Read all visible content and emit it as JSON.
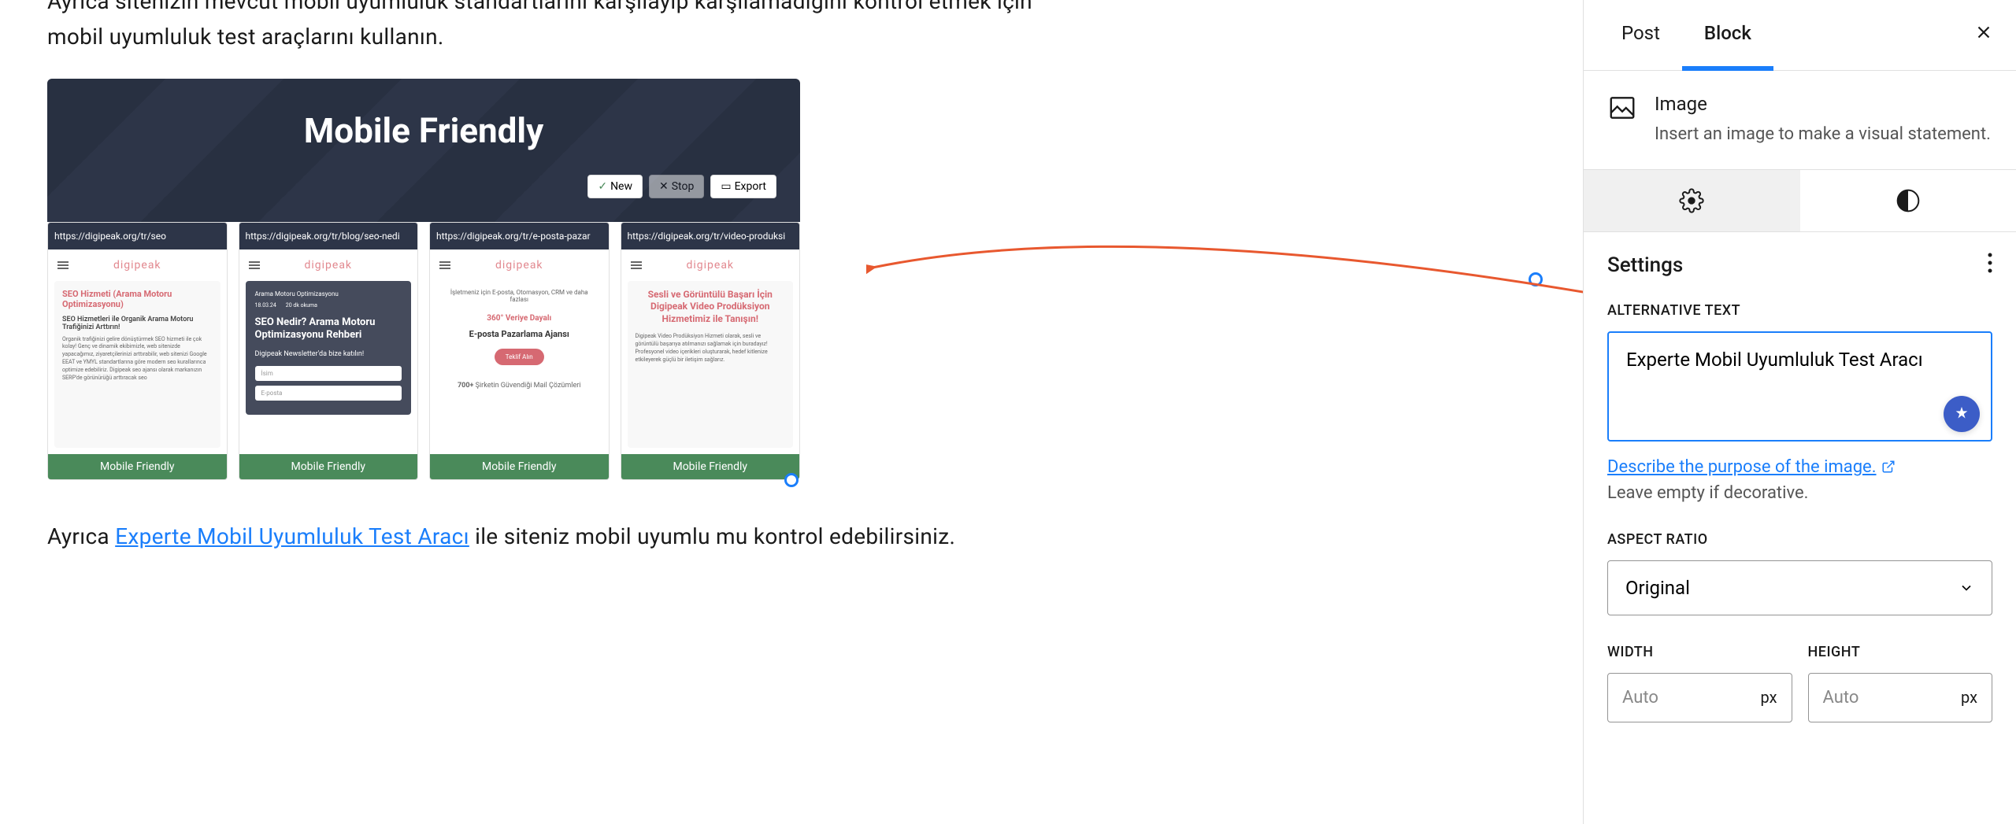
{
  "content": {
    "para1_line1": "Ayrıca sitenizin mevcut mobil uyumluluk standartlarını karşılayıp karşılamadığını kontrol etmek için",
    "para1_line2": "mobil uyumluluk test araçlarını kullanın.",
    "para2_before": "Ayrıca ",
    "para2_link": "Experte Mobil Uyumluluk Test Aracı",
    "para2_after": " ile siteniz mobil uyumlu mu kontrol edebilirsiniz."
  },
  "image": {
    "header_title": "Mobile Friendly",
    "btn_new": "New",
    "btn_stop": "Stop",
    "btn_export": "Export",
    "badge": "Mobile Friendly",
    "cards": [
      {
        "url": "https://digipeak.org/tr/seo",
        "logo": "digipeak",
        "title": "SEO Hizmeti (Arama Motoru Optimizasyonu)",
        "subtitle": "SEO Hizmetleri ile Organik Arama Motoru Trafiğinizi Arttırın!",
        "text": "Organik trafiğinizi gelire dönüştürmek SEO hizmeti ile çok kolay! Genç ve dinamik ekibimizle, web sitenizde yapacağımız, ziyaretçilerinizi arttırabilir, web sitenizi Google EEAT ve YMYL standartlarına göre modern seo kurallarınca optimize edebiliriz. Digipeak seo ajansı olarak markanızın SERP'de görünürüğü arttıracak seo"
      },
      {
        "url": "https://digipeak.org/tr/blog/seo-nedi",
        "logo": "digipeak",
        "category": "Arama Motoru Optimizasyonu",
        "date": "18.03.24",
        "read": "20 dk okuma",
        "title": "SEO Nedir? Arama Motoru Optimizasyonu Rehberi",
        "newsletter": "Digipeak Newsletter'da bize katılın!",
        "input1": "İsim",
        "input2": "E-posta"
      },
      {
        "url": "https://digipeak.org/tr/e-posta-pazar",
        "logo": "digipeak",
        "intro": "İşletmeniz için E-posta, Otomasyon, CRM ve daha fazlası",
        "tag": "360° Veriye Dayalı",
        "title": "E-posta Pazarlama Ajansı",
        "button": "Teklif Alın",
        "footer_bold": "700+",
        "footer_text": " Şirketin Güvendiği Mail Çözümleri"
      },
      {
        "url": "https://digipeak.org/tr/video-produksi",
        "logo": "digipeak",
        "title": "Sesli ve Görüntülü Başarı İçin Digipeak Video Prodüksiyon Hizmetimiz ile Tanışın!",
        "text": "Digipeak Video Prodüksiyon Hizmeti olarak, sesli ve görüntülü başarıya atılmanızı sağlamak için buradayız! Profesyonel video içerikleri oluşturarak, hedef kitlenize etkileyerek güçlü bir iletişim sağlarız."
      }
    ]
  },
  "sidebar": {
    "tabs": {
      "post": "Post",
      "block": "Block"
    },
    "block_info": {
      "name": "Image",
      "desc": "Insert an image to make a visual statement."
    },
    "settings": {
      "title": "Settings",
      "alt_label": "ALTERNATIVE TEXT",
      "alt_value": "Experte Mobil Uyumluluk Test Aracı",
      "describe_link": "Describe the purpose of the image.",
      "helper": "Leave empty if decorative.",
      "aspect_label": "ASPECT RATIO",
      "aspect_value": "Original",
      "width_label": "WIDTH",
      "width_placeholder": "Auto",
      "width_unit": "px",
      "height_label": "HEIGHT",
      "height_placeholder": "Auto",
      "height_unit": "px"
    }
  }
}
